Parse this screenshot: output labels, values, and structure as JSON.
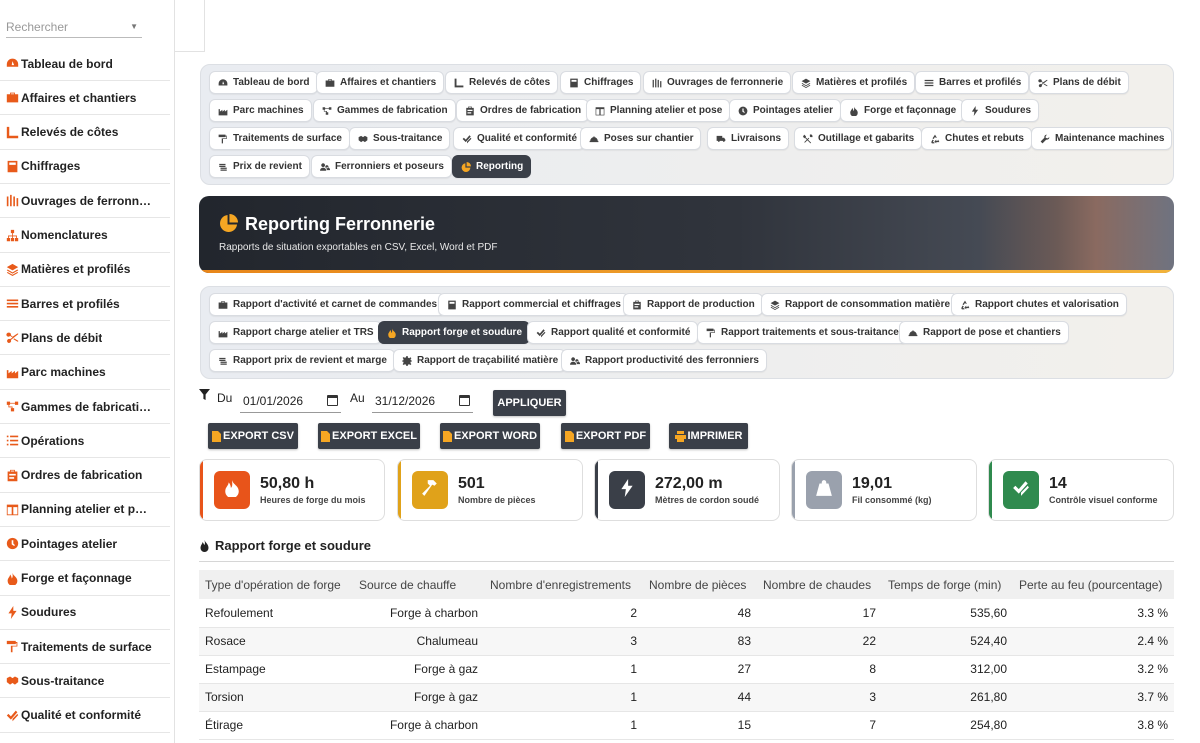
{
  "search": {
    "placeholder": "Rechercher"
  },
  "sidebar": [
    {
      "label": "Tableau de bord",
      "icon": "gauge-icon"
    },
    {
      "label": "Affaires et chantiers",
      "icon": "briefcase-icon"
    },
    {
      "label": "Relevés de côtes",
      "icon": "ruler-icon"
    },
    {
      "label": "Chiffrages",
      "icon": "calculator-icon"
    },
    {
      "label": "Ouvrages de ferronn…",
      "icon": "gate-icon"
    },
    {
      "label": "Nomenclatures",
      "icon": "sitemap-icon"
    },
    {
      "label": "Matières et profilés",
      "icon": "layers-icon"
    },
    {
      "label": "Barres et profilés",
      "icon": "bars-icon"
    },
    {
      "label": "Plans de débit",
      "icon": "scissors-icon"
    },
    {
      "label": "Parc machines",
      "icon": "industry-icon"
    },
    {
      "label": "Gammes de fabricati…",
      "icon": "flow-icon"
    },
    {
      "label": "Opérations",
      "icon": "list-icon"
    },
    {
      "label": "Ordres de fabrication",
      "icon": "clipboard-icon"
    },
    {
      "label": "Planning atelier et p…",
      "icon": "calendar-icon"
    },
    {
      "label": "Pointages atelier",
      "icon": "clock-icon"
    },
    {
      "label": "Forge et façonnage",
      "icon": "fire-icon"
    },
    {
      "label": "Soudures",
      "icon": "bolt-icon"
    },
    {
      "label": "Traitements de surface",
      "icon": "paint-roller-icon"
    },
    {
      "label": "Sous-traitance",
      "icon": "handshake-icon"
    },
    {
      "label": "Qualité et conformité",
      "icon": "check-double-icon"
    }
  ],
  "modules": [
    {
      "label": "Tableau de bord",
      "icon": "gauge-icon"
    },
    {
      "label": "Affaires et chantiers",
      "icon": "briefcase-icon"
    },
    {
      "label": "Relevés de côtes",
      "icon": "ruler-icon"
    },
    {
      "label": "Chiffrages",
      "icon": "calculator-icon"
    },
    {
      "label": "Ouvrages de ferronnerie",
      "icon": "gate-icon"
    },
    {
      "label": "Matières et profilés",
      "icon": "layers-icon"
    },
    {
      "label": "Barres et profilés",
      "icon": "bars-icon"
    },
    {
      "label": "Plans de débit",
      "icon": "scissors-icon"
    },
    {
      "label": "Parc machines",
      "icon": "industry-icon"
    },
    {
      "label": "Gammes de fabrication",
      "icon": "flow-icon"
    },
    {
      "label": "Ordres de fabrication",
      "icon": "clipboard-icon"
    },
    {
      "label": "Planning atelier et pose",
      "icon": "calendar-icon"
    },
    {
      "label": "Pointages atelier",
      "icon": "clock-icon"
    },
    {
      "label": "Forge et façonnage",
      "icon": "fire-icon"
    },
    {
      "label": "Soudures",
      "icon": "bolt-icon"
    },
    {
      "label": "Traitements de surface",
      "icon": "paint-roller-icon"
    },
    {
      "label": "Sous-traitance",
      "icon": "handshake-icon"
    },
    {
      "label": "Qualité et conformité",
      "icon": "check-double-icon"
    },
    {
      "label": "Poses sur chantier",
      "icon": "helmet-icon"
    },
    {
      "label": "Livraisons",
      "icon": "truck-icon"
    },
    {
      "label": "Outillage et gabarits",
      "icon": "tools-icon"
    },
    {
      "label": "Chutes et rebuts",
      "icon": "recycle-icon"
    },
    {
      "label": "Maintenance machines",
      "icon": "wrench-icon"
    },
    {
      "label": "Prix de revient",
      "icon": "coins-icon"
    },
    {
      "label": "Ferronniers et poseurs",
      "icon": "users-icon"
    },
    {
      "label": "Reporting",
      "icon": "pie-chart-icon",
      "active": true
    }
  ],
  "banner": {
    "title": "Reporting Ferronnerie",
    "subtitle": "Rapports de situation exportables en CSV, Excel, Word et PDF"
  },
  "reports": [
    {
      "label": "Rapport d'activité et carnet de commandes",
      "icon": "briefcase-icon"
    },
    {
      "label": "Rapport commercial et chiffrages",
      "icon": "calculator-icon"
    },
    {
      "label": "Rapport de production",
      "icon": "clipboard-icon"
    },
    {
      "label": "Rapport de consommation matière",
      "icon": "layers-icon"
    },
    {
      "label": "Rapport chutes et valorisation",
      "icon": "recycle-icon"
    },
    {
      "label": "Rapport charge atelier et TRS",
      "icon": "industry-icon"
    },
    {
      "label": "Rapport forge et soudure",
      "icon": "fire-icon",
      "active": true
    },
    {
      "label": "Rapport qualité et conformité",
      "icon": "check-double-icon"
    },
    {
      "label": "Rapport traitements et sous-traitance",
      "icon": "paint-roller-icon"
    },
    {
      "label": "Rapport de pose et chantiers",
      "icon": "helmet-icon"
    },
    {
      "label": "Rapport prix de revient et marge",
      "icon": "coins-icon"
    },
    {
      "label": "Rapport de traçabilité matière",
      "icon": "cog-icon"
    },
    {
      "label": "Rapport productivité des ferronniers",
      "icon": "users-icon"
    }
  ],
  "filters": {
    "du_label": "Du",
    "au_label": "Au",
    "date_from": "01/01/2026",
    "date_to": "31/12/2026",
    "apply": "APPLIQUER"
  },
  "exports": {
    "csv": "EXPORT CSV",
    "excel": "EXPORT EXCEL",
    "word": "EXPORT WORD",
    "pdf": "EXPORT PDF",
    "print": "IMPRIMER"
  },
  "kpis": [
    {
      "value": "50,80 h",
      "label": "Heures de forge du mois",
      "color": "#e8541a",
      "icon": "fire-icon"
    },
    {
      "value": "501",
      "label": "Nombre de pièces",
      "color": "#e0a21a",
      "icon": "hammer-icon"
    },
    {
      "value": "272,00 m",
      "label": "Mètres de cordon soudé",
      "color": "#3a3f48",
      "icon": "bolt-icon"
    },
    {
      "value": "19,01",
      "label": "Fil consommé (kg)",
      "color": "#9aa1ad",
      "icon": "weight-icon"
    },
    {
      "value": "14",
      "label": "Contrôle visuel conforme",
      "color": "#2f8a4e",
      "icon": "check-double-icon"
    }
  ],
  "section_title": "Rapport forge et soudure",
  "table": {
    "headers": [
      "Type d'opération de forge",
      "Source de chauffe",
      "Nombre d'enregistrements",
      "Nombre de pièces",
      "Nombre de chaudes",
      "Temps de forge (min)",
      "Perte au feu (pourcentage)"
    ],
    "rows": [
      [
        "Refoulement",
        "Forge à charbon",
        "2",
        "48",
        "17",
        "535,60",
        "3.3 %"
      ],
      [
        "Rosace",
        "Chalumeau",
        "3",
        "83",
        "22",
        "524,40",
        "2.4 %"
      ],
      [
        "Estampage",
        "Forge à gaz",
        "1",
        "27",
        "8",
        "312,00",
        "3.2 %"
      ],
      [
        "Torsion",
        "Forge à gaz",
        "1",
        "44",
        "3",
        "261,80",
        "3.7 %"
      ],
      [
        "Étirage",
        "Forge à charbon",
        "1",
        "15",
        "7",
        "254,80",
        "3.8 %"
      ]
    ]
  }
}
